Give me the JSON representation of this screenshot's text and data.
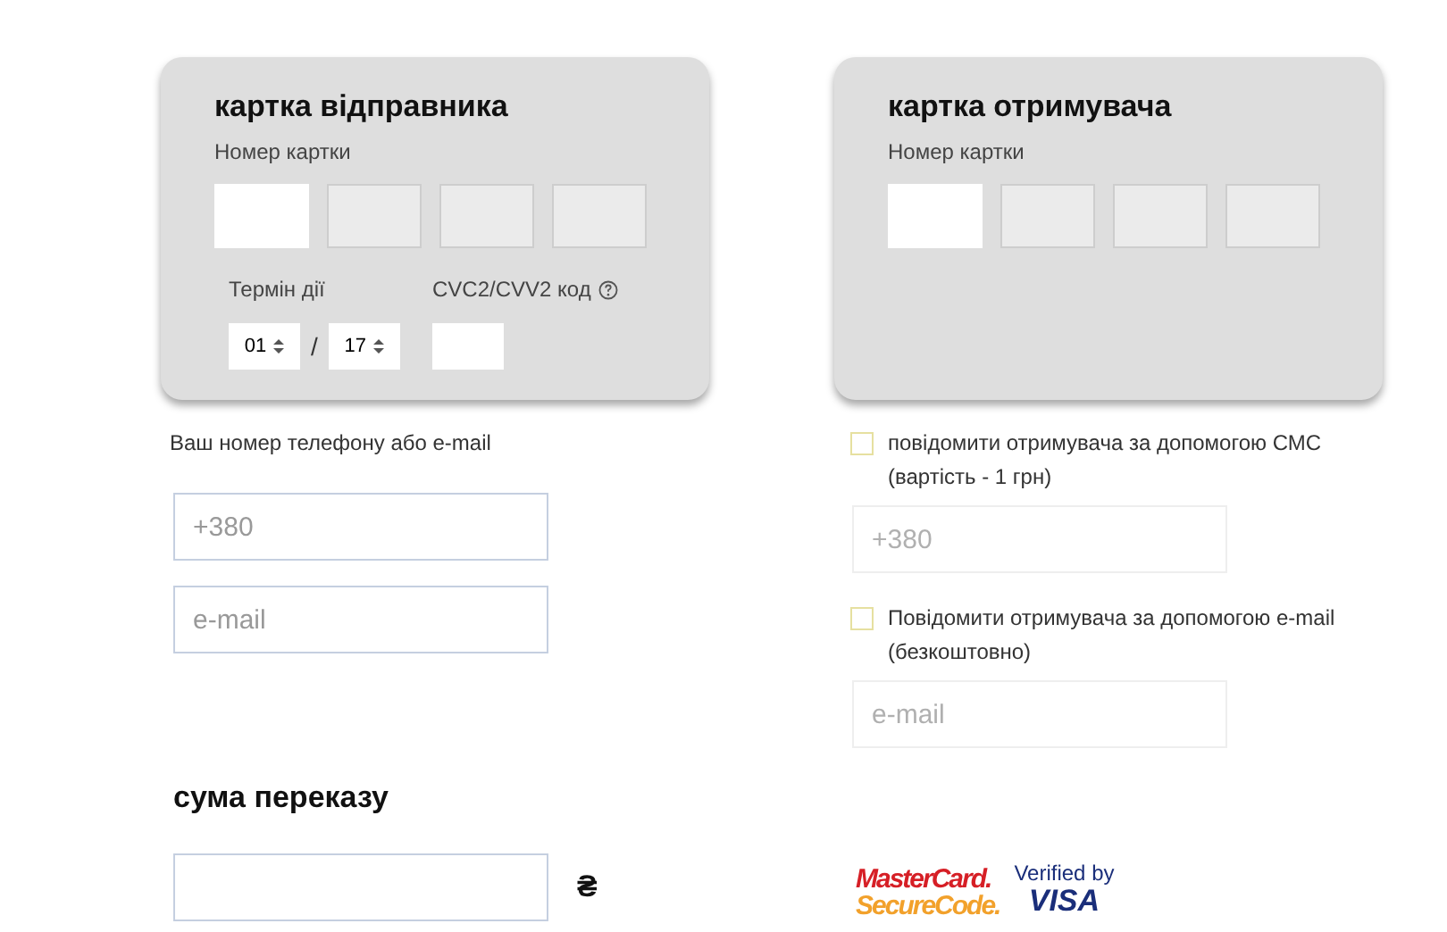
{
  "sender_card": {
    "title": "картка відправника",
    "number_label": "Номер картки",
    "number_fields": [
      {
        "active": true
      },
      {
        "active": false
      },
      {
        "active": false
      },
      {
        "active": false
      }
    ],
    "expiry": {
      "label": "Термін дії",
      "month": "01",
      "separator": "/",
      "year": "17"
    },
    "cvc": {
      "label": "CVC2/CVV2 код"
    }
  },
  "recipient_card": {
    "title": "картка отримувача",
    "number_label": "Номер картки",
    "number_fields": [
      {
        "active": true
      },
      {
        "active": false
      },
      {
        "active": false
      },
      {
        "active": false
      }
    ]
  },
  "contact": {
    "label": "Ваш номер телефону або e-mail",
    "fields": [
      {
        "placeholder": "+380"
      },
      {
        "placeholder": "e-mail"
      }
    ]
  },
  "notify": [
    {
      "label": "повідомити отримувача за допомогою СМС",
      "note": "(вартість - 1 грн)",
      "checked": false,
      "placeholder": "+380"
    },
    {
      "label": "Повідомити отримувача за допомогою e-mail",
      "note": "(безкоштовно)",
      "checked": false,
      "placeholder": "e-mail"
    }
  ],
  "amount": {
    "title": "сума переказу",
    "currency": "₴"
  },
  "badges": {
    "mastercard_line1": "MasterCard.",
    "mastercard_line2": "SecureCode.",
    "visa_line1": "Verified by",
    "visa_line2": "VISA"
  }
}
